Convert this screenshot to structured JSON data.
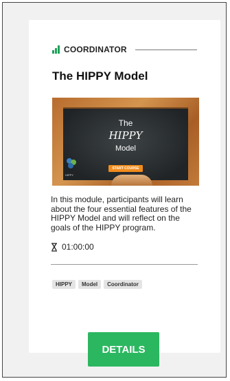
{
  "card": {
    "category_label": "COORDINATOR",
    "title": "The HIPPY Model",
    "thumbnail": {
      "line1": "The",
      "line2": "HIPPY",
      "line3": "Model",
      "button_label": "START COURSE",
      "logo_text": "HIPPY"
    },
    "description": "In this module, participants will learn about the four essential features of the HIPPY Model and will reflect on the goals of the HIPPY program.",
    "duration": "01:00:00",
    "tags": [
      "HIPPY",
      "Model",
      "Coordinator"
    ],
    "details_label": "DETAILS"
  },
  "colors": {
    "accent_green": "#2bb760",
    "icon_green": "#1fa05a"
  },
  "icons": {
    "category": "bar-chart-icon",
    "duration": "hourglass-icon"
  }
}
